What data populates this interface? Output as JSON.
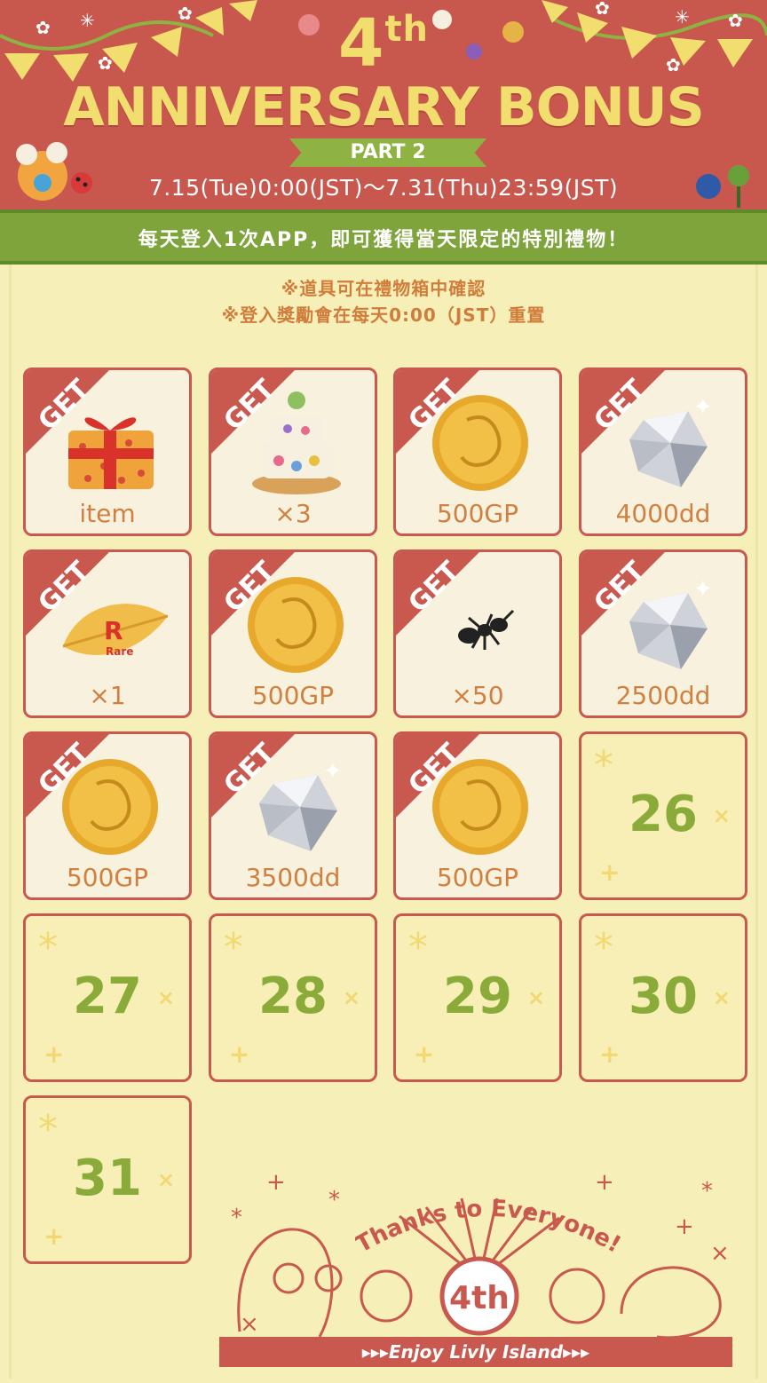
{
  "header": {
    "title_4th": "4",
    "title_4th_suffix": "th",
    "title_main": "ANNIVERSARY BONUS",
    "part": "PART 2",
    "date_range": "7.15(Tue)0:00(JST)～7.31(Thu)23:59(JST)"
  },
  "banner_message": "每天登入1次APP，即可獲得當天限定的特別禮物！",
  "notes": [
    "※道具可在禮物箱中確認",
    "※登入獎勵會在每天0:00（JST）重置"
  ],
  "get_label": "GET",
  "rewards": [
    {
      "label": "item",
      "icon": "gift-box-icon",
      "got": true
    },
    {
      "label": "×3",
      "icon": "flower-cake-icon",
      "got": true
    },
    {
      "label": "500GP",
      "icon": "gold-coin-icon",
      "got": true
    },
    {
      "label": "4000dd",
      "icon": "diamond-icon",
      "got": true
    },
    {
      "label": "×1",
      "icon": "rare-leaf-icon",
      "got": true
    },
    {
      "label": "500GP",
      "icon": "gold-coin-icon",
      "got": true
    },
    {
      "label": "×50",
      "icon": "ant-icon",
      "got": true
    },
    {
      "label": "2500dd",
      "icon": "diamond-icon",
      "got": true
    },
    {
      "label": "500GP",
      "icon": "gold-coin-icon",
      "got": true
    },
    {
      "label": "3500dd",
      "icon": "diamond-icon",
      "got": true
    },
    {
      "label": "500GP",
      "icon": "gold-coin-icon",
      "got": true
    }
  ],
  "future_days": [
    "26",
    "27",
    "28",
    "29",
    "30",
    "31"
  ],
  "footer": {
    "thanks": "Thanks to Everyone!",
    "badge": "4th",
    "enjoy": "▸▸▸Enjoy Livly Island▸▸▸"
  },
  "colors": {
    "header_red": "#c8574e",
    "title_yellow": "#f1de6e",
    "green": "#7fa43c",
    "card_border": "#c9584f",
    "note_orange": "#d07d3c",
    "day_green": "#8aab3a"
  }
}
